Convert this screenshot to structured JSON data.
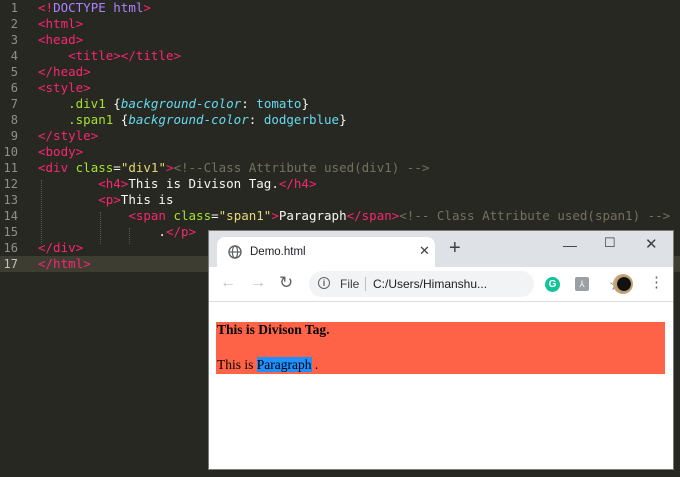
{
  "editor": {
    "active_line": "17",
    "lines": [
      {
        "n": "1",
        "segs": [
          [
            "tag",
            "<!"
          ],
          [
            "doc",
            "DOCTYPE html"
          ],
          [
            "tag",
            ">"
          ]
        ]
      },
      {
        "n": "2",
        "segs": [
          [
            "tag",
            "<html>"
          ]
        ]
      },
      {
        "n": "3",
        "segs": [
          [
            "tag",
            "<head>"
          ]
        ]
      },
      {
        "n": "4",
        "segs": [
          [
            "txt",
            "    "
          ],
          [
            "tag",
            "<title></title>"
          ]
        ]
      },
      {
        "n": "5",
        "segs": [
          [
            "tag",
            "</head>"
          ]
        ]
      },
      {
        "n": "6",
        "segs": [
          [
            "tag",
            "<style>"
          ]
        ]
      },
      {
        "n": "7",
        "segs": [
          [
            "txt",
            "    "
          ],
          [
            "attr",
            ".div1"
          ],
          [
            "txt",
            " {"
          ],
          [
            "prop",
            "background-color"
          ],
          [
            "txt",
            ": "
          ],
          [
            "val",
            "tomato"
          ],
          [
            "txt",
            "}"
          ]
        ]
      },
      {
        "n": "8",
        "segs": [
          [
            "txt",
            "    "
          ],
          [
            "attr",
            ".span1"
          ],
          [
            "txt",
            " {"
          ],
          [
            "prop",
            "background-color"
          ],
          [
            "txt",
            ": "
          ],
          [
            "val",
            "dodgerblue"
          ],
          [
            "txt",
            "}"
          ]
        ]
      },
      {
        "n": "9",
        "segs": [
          [
            "tag",
            "</style>"
          ]
        ]
      },
      {
        "n": "10",
        "segs": [
          [
            "tag",
            "<body>"
          ]
        ]
      },
      {
        "n": "11",
        "segs": [
          [
            "tag",
            "<div "
          ],
          [
            "attr",
            "class"
          ],
          [
            "txt",
            "="
          ],
          [
            "str",
            "\"div1\""
          ],
          [
            "tag",
            ">"
          ],
          [
            "cmt",
            "<!--Class Attribute used(div1) -->"
          ]
        ]
      },
      {
        "n": "12",
        "segs": [
          [
            "txt",
            "        "
          ],
          [
            "tag",
            "<h4>"
          ],
          [
            "txt",
            "This is Divison Tag."
          ],
          [
            "tag",
            "</h4>"
          ]
        ]
      },
      {
        "n": "13",
        "segs": [
          [
            "txt",
            "        "
          ],
          [
            "tag",
            "<p>"
          ],
          [
            "txt",
            "This is"
          ]
        ]
      },
      {
        "n": "14",
        "segs": [
          [
            "txt",
            "            "
          ],
          [
            "tag",
            "<span "
          ],
          [
            "attr",
            "class"
          ],
          [
            "txt",
            "="
          ],
          [
            "str",
            "\"span1\""
          ],
          [
            "tag",
            ">"
          ],
          [
            "txt",
            "Paragraph"
          ],
          [
            "tag",
            "</span>"
          ],
          [
            "cmt",
            "<!-- Class Attribute used(span1) -->"
          ]
        ]
      },
      {
        "n": "15",
        "segs": [
          [
            "txt",
            "                ."
          ],
          [
            "tag",
            "</p>"
          ]
        ]
      },
      {
        "n": "16",
        "segs": [
          [
            "tag",
            "</div>"
          ]
        ]
      },
      {
        "n": "17",
        "segs": [
          [
            "tag",
            "</html>"
          ]
        ]
      }
    ]
  },
  "browser": {
    "tab_title": "Demo.html",
    "tab_close": "✕",
    "new_tab": "+",
    "window_minimize": "—",
    "window_maximize": "☐",
    "window_close": "✕",
    "back": "←",
    "forward": "→",
    "reload": "↻",
    "info": "i",
    "scheme": "File",
    "url": "C:/Users/Himanshu...",
    "bookmark": "☆",
    "ext_grammarly": "G",
    "ext_second": "⅄",
    "menu": "⋮",
    "page": {
      "heading": "This is Divison Tag.",
      "para_before": "This is ",
      "span_text": "Paragraph",
      "para_after": " .",
      "div_background": "#ff6347",
      "span_background": "#1e90ff"
    }
  }
}
